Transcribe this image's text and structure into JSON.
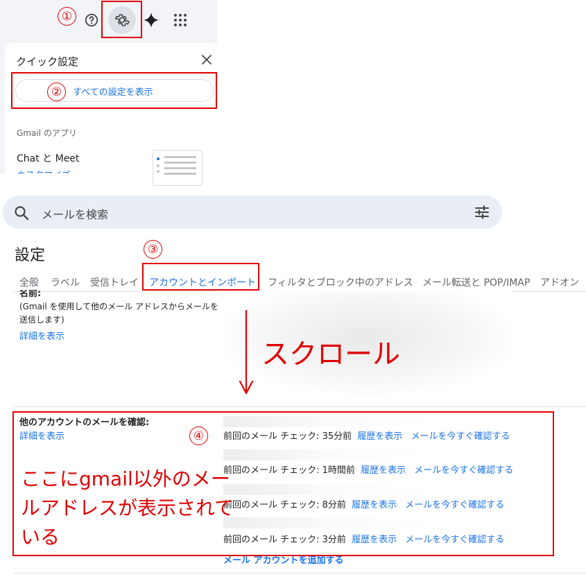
{
  "quick_settings": {
    "title": "クイック設定",
    "all_settings_button": "すべての設定を表示",
    "apps_heading": "Gmail のアプリ",
    "chat_meet": "Chat と Meet",
    "customize_link": "カスタマイズ"
  },
  "search": {
    "placeholder": "メールを検索"
  },
  "settings": {
    "title": "設定",
    "tabs": [
      "全般",
      "ラベル",
      "受信トレイ",
      "アカウントとインポート",
      "フィルタとブロック中のアドレス",
      "メール転送と POP/IMAP",
      "アドオン"
    ],
    "name_label": "名前:",
    "name_description": "(Gmail を使用して他のメール アドレスからメールを送信します)",
    "details_link": "詳細を表示",
    "check_mail_label": "他のアカウントのメールを確認:",
    "accounts": [
      {
        "last_check": "前回のメール チェック: 35分前",
        "history": "履歴を表示",
        "check_now": "メールを今すぐ確認する"
      },
      {
        "last_check": "前回のメール チェック: 1時間前",
        "history": "履歴を表示",
        "check_now": "メールを今すぐ確認する"
      },
      {
        "last_check": "前回のメール チェック: 8分前",
        "history": "履歴を表示",
        "check_now": "メールを今すぐ確認する"
      },
      {
        "last_check": "前回のメール チェック: 3分前",
        "history": "履歴を表示",
        "check_now": "メールを今すぐ確認する"
      }
    ],
    "add_account": "メール アカウントを追加する"
  },
  "annotations": {
    "steps": [
      "①",
      "②",
      "③",
      "④"
    ],
    "scroll": "スクロール",
    "note": "ここにgmail以外のメールアドレスが表示されている",
    "color": "#e00000"
  },
  "icons": [
    "help-icon",
    "gear-icon",
    "gemini-sparkle-icon",
    "apps-grid-icon",
    "close-icon",
    "search-icon",
    "search-filter-icon"
  ]
}
